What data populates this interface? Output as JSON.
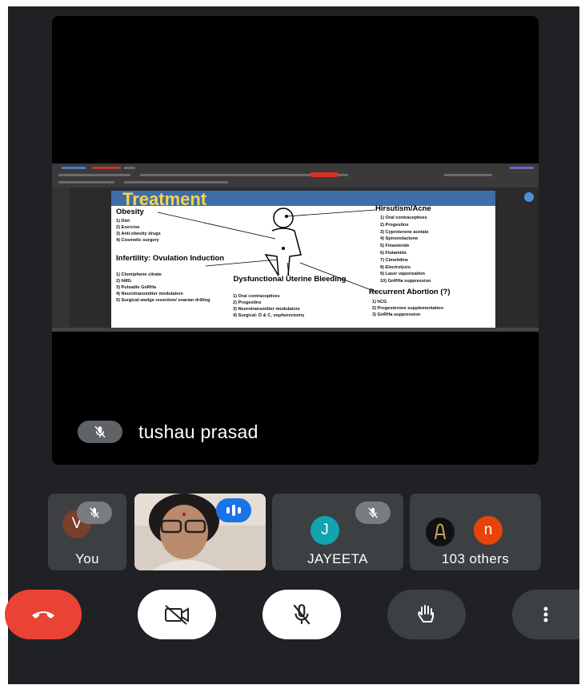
{
  "presenter": {
    "name": "tushau prasad",
    "shared_slide": {
      "title": "Treatment",
      "sections": [
        {
          "heading": "Obesity",
          "items": [
            "1) Diet",
            "2) Exercise",
            "3) Anti-obesity drugs",
            "4) Cosmetic surgery"
          ]
        },
        {
          "heading": "Infertility: Ovulation Induction",
          "items": [
            "1) Clomiphene citrate",
            "2) hMG",
            "3) Pulsatile GnRHa",
            "4) Neurotransmitter modulators",
            "5) Surgical-wedge resection/ ovarian drilling"
          ]
        },
        {
          "heading": "Dysfunctional Uterine Bleeding",
          "items": [
            "1) Oral contraceptives",
            "2) Progestins",
            "3) Neurotransmitter modulators",
            "4) Surgical: D & C, oophorectomy"
          ]
        },
        {
          "heading": "Hirsutism/Acne",
          "items": [
            "1) Oral contraceptives",
            "2) Progestins",
            "3) Cyproterone acetate",
            "4) Spironolactone",
            "5) Finasteride",
            "6) Flutamide",
            "7) Cimetidine",
            "8) Electrolysis",
            "9) Laser vaporization",
            "10) GnRHa suppression"
          ]
        },
        {
          "heading": "Recurrent Abortion (?)",
          "items": [
            "1) hCG",
            "2) Progesterone supplementation",
            "3) GnRHa suppression"
          ]
        }
      ]
    }
  },
  "participants": [
    {
      "label": "You",
      "initial": "V",
      "muted": true
    },
    {
      "label": "",
      "speaking": true
    },
    {
      "label": "JAYEETA",
      "initial": "J",
      "muted": true
    },
    {
      "label": "103 others",
      "initial": "n"
    }
  ],
  "colors": {
    "end_call": "#ea4335",
    "avatar_you": "#7a3e2e",
    "avatar_j": "#12a4af",
    "avatar_n": "#e8430a",
    "speaking_badge": "#1a73e8",
    "tile_bg": "#3c4043",
    "bg": "#202124"
  },
  "controls": [
    "end-call",
    "camera-off",
    "mic-off",
    "raise-hand",
    "more-options"
  ]
}
